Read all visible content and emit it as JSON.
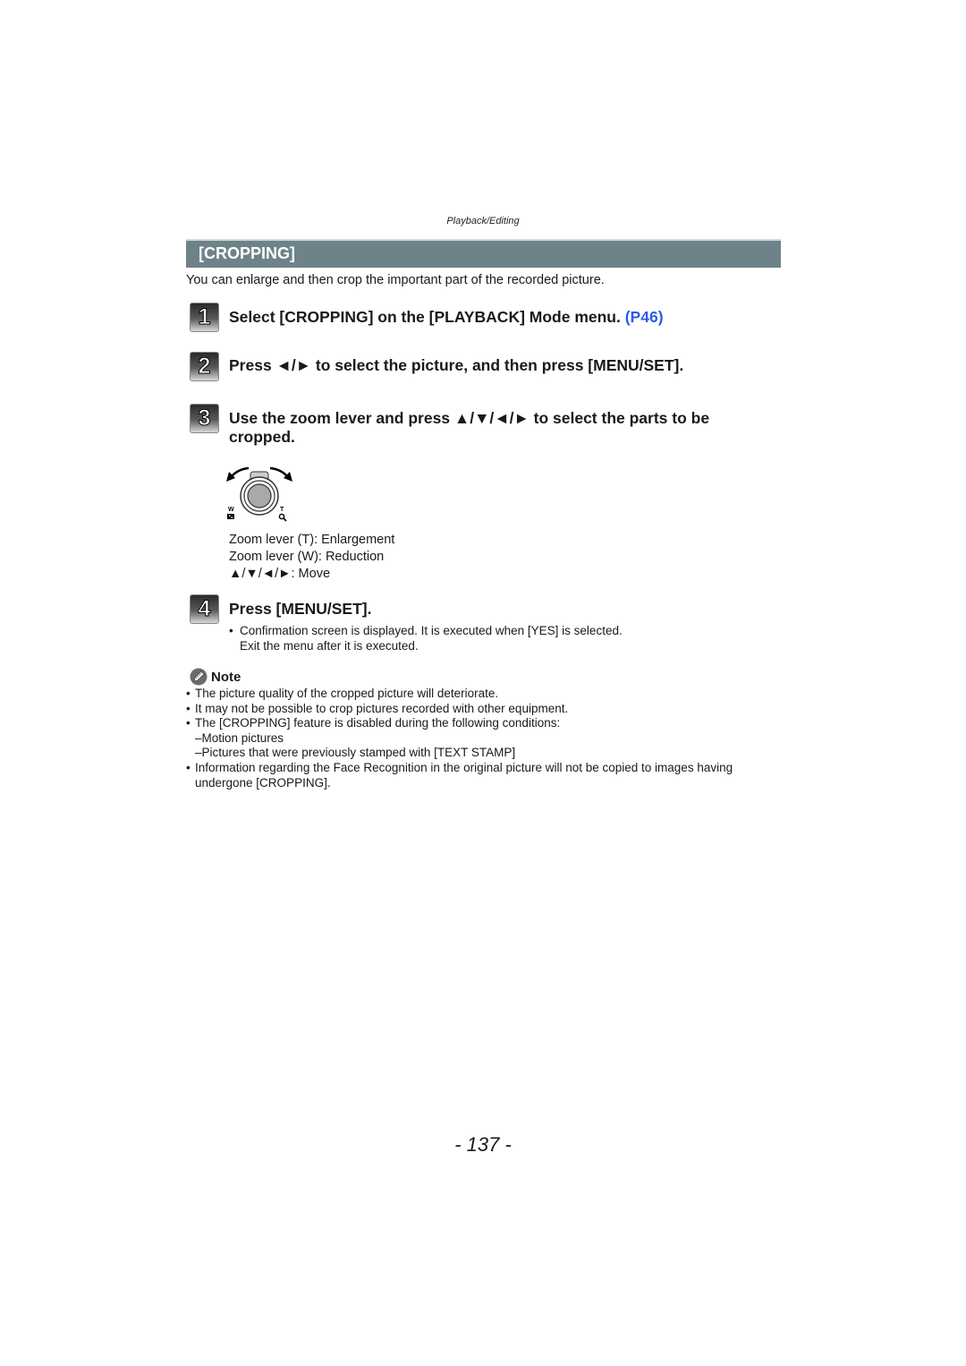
{
  "running_head": "Playback/Editing",
  "section_title": "[CROPPING]",
  "intro": "You can enlarge and then crop the important part of the recorded picture.",
  "steps": [
    {
      "number": "1",
      "text": "Select [CROPPING] on the [PLAYBACK] Mode menu.",
      "link": "(P46)"
    },
    {
      "number": "2",
      "text": "Press ◄/► to select the picture, and then press [MENU/SET]."
    },
    {
      "number": "3",
      "text": "Use the zoom lever and press ▲/▼/◄/► to select the parts to be cropped."
    },
    {
      "number": "4",
      "text": "Press [MENU/SET]."
    }
  ],
  "zoom_lever": {
    "w_label": "W",
    "t_label": "T",
    "lines": [
      "Zoom lever (T): Enlargement",
      "Zoom lever (W): Reduction",
      "▲/▼/◄/►: Move"
    ]
  },
  "step4_detail": [
    "Confirmation screen is displayed. It is executed when [YES] is selected.",
    "Exit the menu after it is executed."
  ],
  "note": {
    "heading": "Note",
    "items": [
      "The picture quality of the cropped picture will deteriorate.",
      "It may not be possible to crop pictures recorded with other equipment.",
      "The [CROPPING] feature is disabled during the following conditions:"
    ],
    "sub_items": [
      "–Motion pictures",
      "–Pictures that were previously stamped with [TEXT STAMP]"
    ],
    "last_item": "Information regarding the Face Recognition in the original picture will not be copied to images having undergone [CROPPING]."
  },
  "page_number": "- 137 -"
}
